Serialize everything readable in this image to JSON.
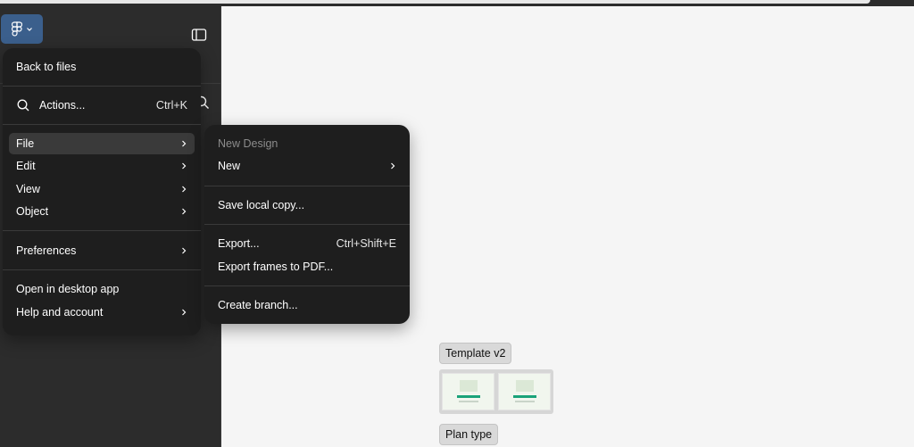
{
  "main_menu": {
    "back": "Back to files",
    "actions": {
      "label": "Actions...",
      "shortcut": "Ctrl+K"
    },
    "file": "File",
    "edit": "Edit",
    "view": "View",
    "object": "Object",
    "preferences": "Preferences",
    "open_desktop": "Open in desktop app",
    "help": "Help and account"
  },
  "file_submenu": {
    "file_name": "New Design",
    "new": "New",
    "save_local": "Save local copy...",
    "export": {
      "label": "Export...",
      "shortcut": "Ctrl+Shift+E"
    },
    "export_pdf": "Export frames to PDF...",
    "create_branch": "Create branch..."
  },
  "canvas": {
    "frame1": "Template v2",
    "frame2": "Plan type"
  },
  "colors": {
    "menu_bg": "#1e1e1e",
    "sidebar_bg": "#2c2c2c",
    "logo_button_bg": "#3b5f8c",
    "canvas_bg": "#f5f5f5"
  }
}
